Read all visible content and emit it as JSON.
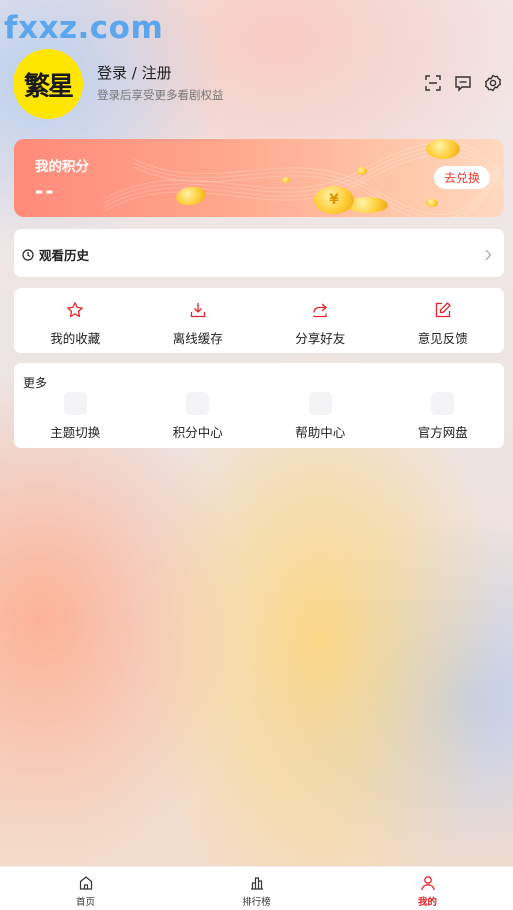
{
  "watermark": "fxxz.com",
  "profile": {
    "avatar_text": "繁星",
    "login_title": "登录 / 注册",
    "login_subtitle": "登录后享受更多看剧权益"
  },
  "header_icons": [
    "scan-icon",
    "message-icon",
    "gear-icon"
  ],
  "points": {
    "title": "我的积分",
    "value": "--",
    "redeem_label": "去兑换",
    "coin_symbol": "¥"
  },
  "history": {
    "label": "观看历史"
  },
  "actions": [
    {
      "label": "我的收藏",
      "icon": "star-icon"
    },
    {
      "label": "离线缓存",
      "icon": "download-icon"
    },
    {
      "label": "分享好友",
      "icon": "share-icon"
    },
    {
      "label": "意见反馈",
      "icon": "edit-icon"
    }
  ],
  "more": {
    "title": "更多",
    "items": [
      {
        "label": "主题切换"
      },
      {
        "label": "积分中心"
      },
      {
        "label": "帮助中心"
      },
      {
        "label": "官方网盘"
      }
    ]
  },
  "tabbar": [
    {
      "label": "首页",
      "icon": "home-icon",
      "active": false
    },
    {
      "label": "排行榜",
      "icon": "chart-icon",
      "active": false
    },
    {
      "label": "我的",
      "icon": "user-icon",
      "active": true
    }
  ],
  "colors": {
    "accent": "#e5242a",
    "avatar_bg": "#ffe600",
    "watermark": "#5aa6ef"
  }
}
